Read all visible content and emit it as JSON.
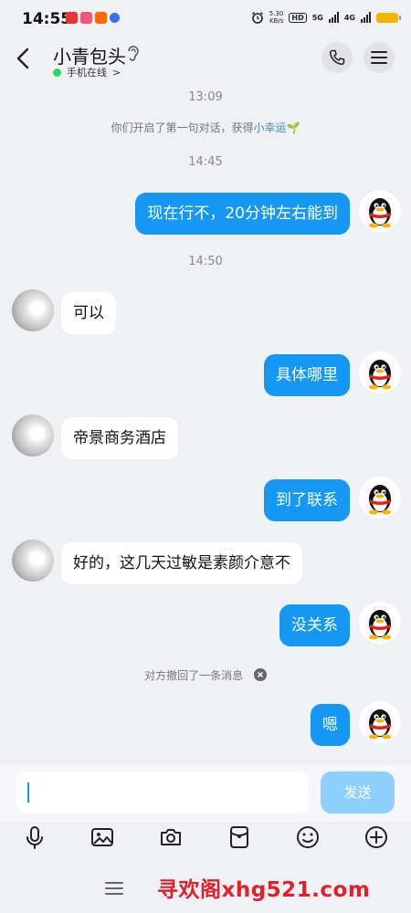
{
  "status_bar": {
    "time": "14:55",
    "speed_value": "5.30",
    "speed_unit": "KB/s",
    "hd_badge": "HD",
    "network_1": "5G",
    "network_2": "4G",
    "app_icons": [
      "tmall-icon",
      "app-icon-red",
      "app-icon-taobao",
      "baidu-icon"
    ]
  },
  "header": {
    "contact_name": "小青包头",
    "online_status": "手机在线",
    "online_chevron": ">"
  },
  "chat": {
    "timestamps": [
      "13:09",
      "14:45",
      "14:50"
    ],
    "system_intro": "你们开启了第一句对话，获得",
    "system_link": "小幸运",
    "system_emoji": "🌱",
    "messages": [
      {
        "from": "me",
        "text": "现在行不，20分钟左右能到"
      },
      {
        "from": "peer",
        "text": "可以"
      },
      {
        "from": "me",
        "text": "具体哪里"
      },
      {
        "from": "peer",
        "text": "帝景商务酒店"
      },
      {
        "from": "me",
        "text": "到了联系"
      },
      {
        "from": "peer",
        "text": "好的，这几天过敏是素颜介意不"
      },
      {
        "from": "me",
        "text": "没关系"
      },
      {
        "from": "me",
        "text": "嗯"
      }
    ],
    "recall_notice": "对方撤回了一条消息"
  },
  "input": {
    "value": "",
    "send_label": "发送"
  },
  "toolbar": [
    "microphone-icon",
    "image-icon",
    "camera-icon",
    "red-packet-icon",
    "emoji-icon",
    "plus-icon"
  ],
  "watermark": "寻欢阁xhg521.com",
  "colors": {
    "outgoing_bubble": "#1597f4",
    "incoming_bubble": "#ffffff",
    "send_button": "#8fcffb",
    "link": "#2f8fe6",
    "online_dot": "#2bd566",
    "watermark": "#e0202a"
  }
}
